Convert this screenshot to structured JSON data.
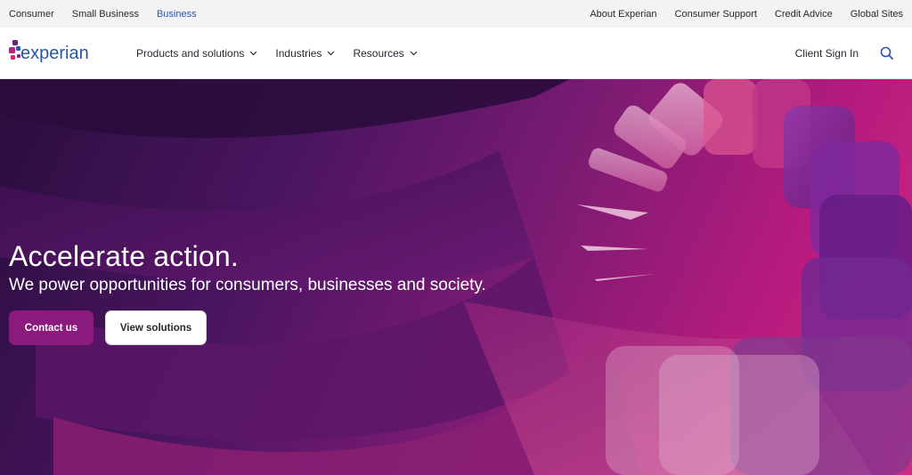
{
  "utility": {
    "left": [
      "Consumer",
      "Small Business",
      "Business"
    ],
    "active_index": 2,
    "right": [
      "About Experian",
      "Consumer Support",
      "Credit Advice",
      "Global Sites"
    ]
  },
  "nav": {
    "logo_text": "experian",
    "items": [
      {
        "label": "Products and solutions",
        "icon": "chevron-down-icon"
      },
      {
        "label": "Industries",
        "icon": "chevron-down-icon"
      },
      {
        "label": "Resources",
        "icon": "chevron-down-icon"
      }
    ],
    "sign_in": "Client Sign In",
    "search_icon": "search-icon"
  },
  "hero": {
    "title": "Accelerate action.",
    "subtitle": "We power opportunities for consumers, businesses and society.",
    "primary_button": "Contact us",
    "secondary_button": "View solutions"
  },
  "colors": {
    "brand_blue": "#2b55a3",
    "brand_magenta": "#8a1a7e",
    "logo_dots": [
      "#6d2077",
      "#b12a7c",
      "#2b55a3",
      "#e31c79",
      "#7c2a82"
    ]
  }
}
